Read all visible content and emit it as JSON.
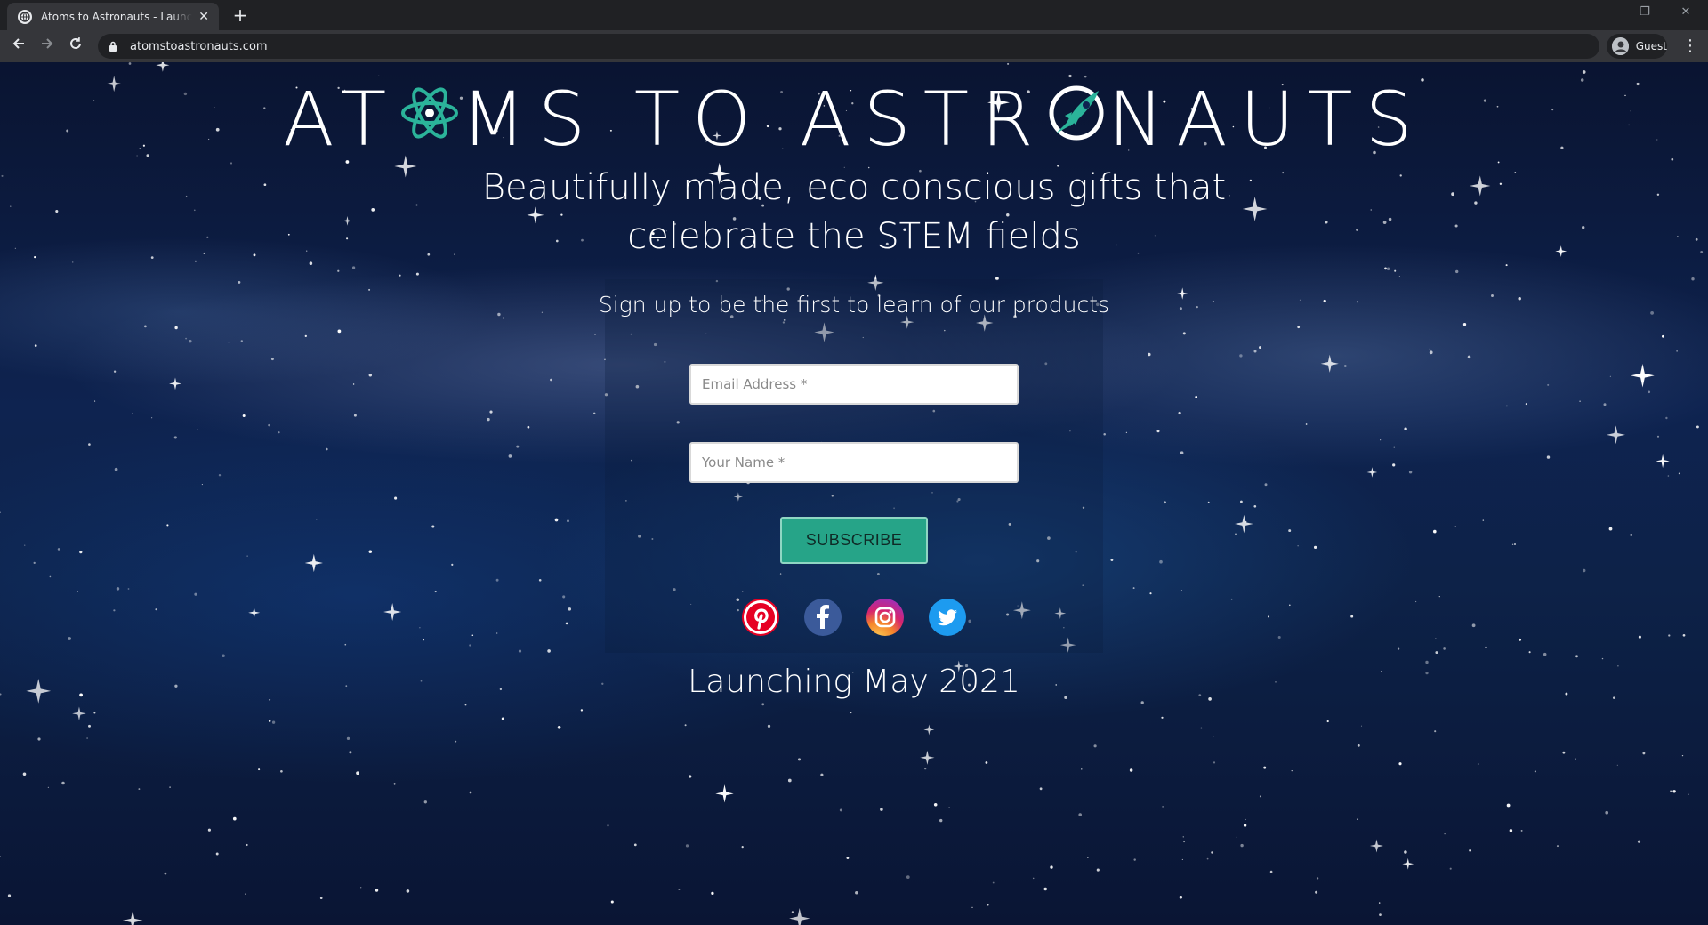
{
  "browser": {
    "tab_title": "Atoms to Astronauts - Launching",
    "tab_close": "✕",
    "new_tab": "+",
    "url": "atomstoastronauts.com",
    "profile_label": "Guest",
    "window_controls": {
      "minimize": "—",
      "restore": "❐",
      "close": "✕"
    }
  },
  "page": {
    "logo": {
      "part1": "AT",
      "part2": "MS TO ASTR",
      "part3": "NAUTS",
      "accent_color": "#2bb39a"
    },
    "tagline_line1": "Beautifully made, eco conscious gifts that",
    "tagline_line2": "celebrate the STEM fields",
    "signup_text": "Sign up to be the first to learn of our products",
    "email_placeholder": "Email Address *",
    "name_placeholder": "Your Name *",
    "subscribe_label": "SUBSCRIBE",
    "socials": [
      {
        "name": "Pinterest",
        "icon": "pinterest-icon",
        "glyph": "P"
      },
      {
        "name": "Facebook",
        "icon": "facebook-icon",
        "glyph": "f"
      },
      {
        "name": "Instagram",
        "icon": "instagram-icon",
        "glyph": ""
      },
      {
        "name": "Twitter",
        "icon": "twitter-icon",
        "glyph": ""
      }
    ],
    "launch_text": "Launching May 2021"
  },
  "colors": {
    "accent": "#2bb39a",
    "button": "#26a488",
    "sky_dark": "#0a1431"
  }
}
